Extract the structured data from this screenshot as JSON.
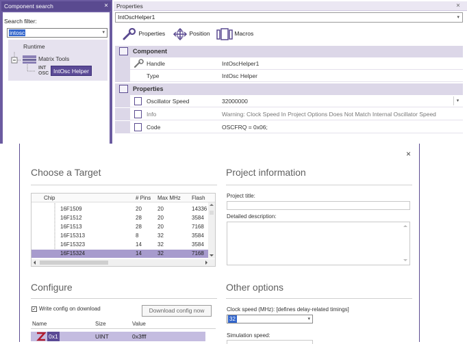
{
  "component_search": {
    "title": "Component search",
    "close": "×",
    "filter_label": "Search filter:",
    "filter_value": "intosc",
    "dropdown": "▾",
    "tree": {
      "runtime": "Runtime",
      "matrix_tools": "Matrix Tools",
      "chip_icon_top": "INT",
      "chip_icon_bottom": "OSC",
      "item": "IntOsc Helper"
    }
  },
  "properties": {
    "title": "Properties",
    "close": "×",
    "object_name": "IntOscHelper1",
    "dropdown": "▾",
    "toolbar": {
      "properties": "Properties",
      "position": "Position",
      "macros": "Macros"
    },
    "sections": {
      "component": "Component",
      "properties": "Properties"
    },
    "rows": {
      "handle_name": "Handle",
      "handle_value": "IntOscHelper1",
      "type_name": "Type",
      "type_value": "IntOsc Helper",
      "osc_name": "Oscillator Speed",
      "osc_value": "32000000",
      "info_name": "Info",
      "info_value": "Warning: Clock Speed In Project Options Does Not Match Internal Oscillator Speed",
      "code_name": "Code",
      "code_value": "OSCFRQ = 0x06;"
    }
  },
  "dialog": {
    "close": "×",
    "choose_target": "Choose a Target",
    "project_information": "Project information",
    "configure": "Configure",
    "other_options": "Other options",
    "table": {
      "headers": {
        "chip": "Chip",
        "pins": "# Pins",
        "mhz": "Max MHz",
        "flash": "Flash"
      },
      "rows": [
        {
          "chip": "16F1509",
          "pins": "20",
          "mhz": "20",
          "flash": "14336"
        },
        {
          "chip": "16F1512",
          "pins": "28",
          "mhz": "20",
          "flash": "3584"
        },
        {
          "chip": "16F1513",
          "pins": "28",
          "mhz": "20",
          "flash": "7168"
        },
        {
          "chip": "16F15313",
          "pins": "8",
          "mhz": "32",
          "flash": "3584"
        },
        {
          "chip": "16F15323",
          "pins": "14",
          "mhz": "32",
          "flash": "3584"
        },
        {
          "chip": "16F15324",
          "pins": "14",
          "mhz": "32",
          "flash": "7168"
        }
      ]
    },
    "project_title_label": "Project title:",
    "detailed_description_label": "Detailed description:",
    "write_config_label": "Write config on download",
    "download_config_button": "Download config now",
    "config_headers": {
      "name": "Name",
      "size": "Size",
      "value": "Value"
    },
    "config_row": {
      "name": "0x1",
      "size": "UINT",
      "value": "0x3fff"
    },
    "clock_speed_label": "Clock speed (MHz): [defines delay-related timings]",
    "clock_speed_value": "32",
    "simulation_speed_label": "Simulation speed:"
  }
}
